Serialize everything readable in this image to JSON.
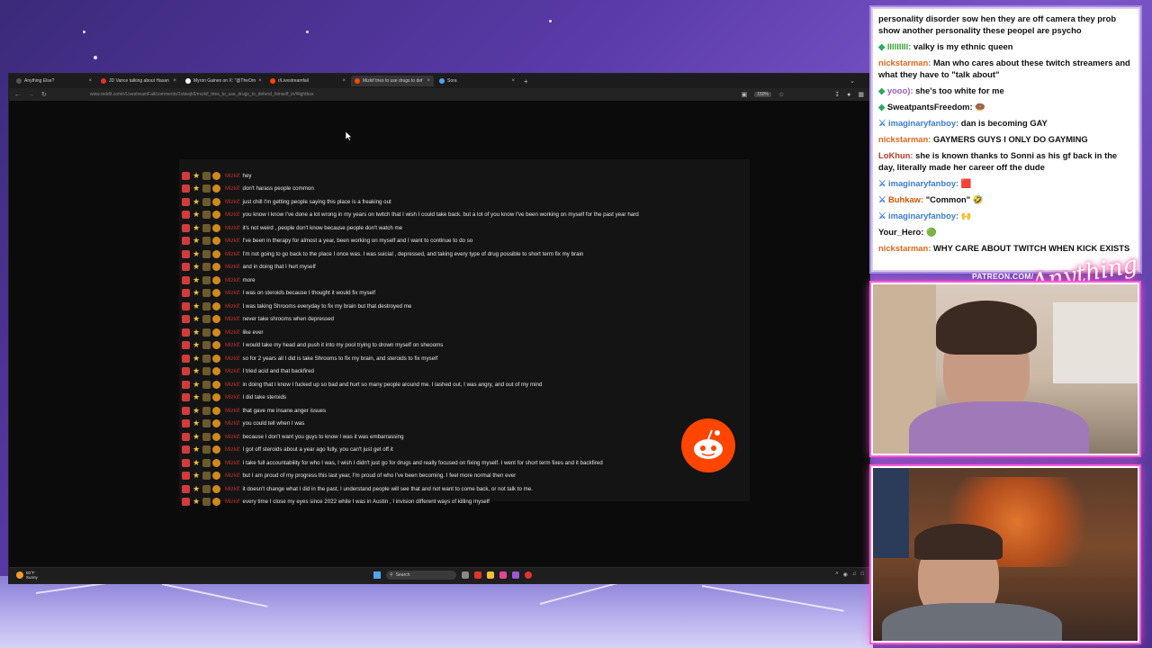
{
  "browser": {
    "tabs": [
      {
        "title": "Anything Else?",
        "favicon_color": "#555555"
      },
      {
        "title": "JD Vance talking about Hasan",
        "favicon_color": "#e0342c"
      },
      {
        "title": "Myron Gaines on X: \"@TheOm",
        "favicon_color": "#ffffff"
      },
      {
        "title": "r/Livestreamfail",
        "favicon_color": "#ff4500"
      },
      {
        "title": "Mizkif tries to use drugs to def",
        "favicon_color": "#ff4500"
      },
      {
        "title": "Sora",
        "favicon_color": "#4ea6f5"
      }
    ],
    "active_tab": 4,
    "url": "www.reddit.com/r/LivestreamFail/comments/1olwejk5/mizkif_tries_to_use_drugs_to_defend_himself_in/#lightbox",
    "zoom": "150%"
  },
  "chat_image": {
    "username": "Mizkif:",
    "messages": [
      "hey",
      "don't harass people common",
      "just chill I'm getting people saying this place is a freaking out",
      "you know I know I've done a lot wrong in my years on twitch that I wish I could take back. but a lot of you know I've been working on myself for the past year hard",
      "it's not weird , people don't know because people don't watch me",
      "I've been in therapy for almost a year, been working on myself and I want to continue to do so",
      "I'm not going to go back to the place I once was. I was suicial , depressed, and taking every type of drug possible to short term fix my brain",
      "and in doing that I hurt myself",
      "more",
      "I was on steroids because I thought it would fix myself",
      "I was taking Shrooms everyday to fix my brain but that destroyed me",
      "never take shrooms when depressed",
      "like ever",
      "I would take my head and push it into my pool trying to drown myself on sheooms",
      "so for 2 years all I did is take Shrooms to fix my brain, and steroids to fix myself",
      "I tried acid and that backfired",
      "in doing that I know I fucked up so bad and hurt so many people around me. I lashed out, I was angry, and out of my mind",
      "I did take steroids",
      "that gave me insane anger issues",
      "you could tell when I was",
      "because I don't want you guys to know I was it was embarrassing",
      "I got off steroids about a year ago fully, you can't just get off it",
      "I take full accountability for who I was, I wish I didn't just go for drugs and really focused on fixing myself. I went for short term fixes and it backfired",
      "but I am proud of my progress this last year, I'm proud of who I've been becoming. I feel more normal then ever",
      "it doesn't change what I did in the past, I understand people will see that and not want to come back, or not talk to me.",
      "every time I close my eyes since 2022 while I was in Austin , I invision different ways of killing myself"
    ]
  },
  "taskbar": {
    "weather_temp": "50°F",
    "weather_desc": "Sunny",
    "search_placeholder": "Search"
  },
  "stream_chat": {
    "top_line": "personality disorder sow hen they are off camera they prob show another personality these peopel are psycho",
    "messages": [
      {
        "user": "lllllllll:",
        "user_color": "#2f9e2f",
        "text": "valky is my ethnic queen",
        "badge": "gem"
      },
      {
        "user": "nickstarman:",
        "user_color": "#e0661a",
        "text": "Man who cares about these twitch streamers and what they have to \"talk about\"",
        "badge": ""
      },
      {
        "user": "yooo):",
        "user_color": "#9b59d0",
        "text": "she's too white for me",
        "badge": "gem"
      },
      {
        "user": "SweatpantsFreedom:",
        "user_color": "#111111",
        "text": "🍩",
        "badge": "gem"
      },
      {
        "user": "imaginaryfanboy:",
        "user_color": "#3a7bd5",
        "text": "dan is becoming GAY",
        "badge": "sword"
      },
      {
        "user": "nickstarman:",
        "user_color": "#e0661a",
        "text": "GAYMERS GUYS I ONLY DO GAYMING",
        "badge": ""
      },
      {
        "user": "LoKhun:",
        "user_color": "#c0392b",
        "text": "she is known thanks to Sonni as his gf back in the day, literally made her career off the dude",
        "badge": ""
      },
      {
        "user": "imaginaryfanboy:",
        "user_color": "#3a7bd5",
        "text": "🟥",
        "badge": "sword"
      },
      {
        "user": "Buhkaw:",
        "user_color": "#d35400",
        "text": "\"Common\" 🤣",
        "badge": "sword"
      },
      {
        "user": "imaginaryfanboy:",
        "user_color": "#3a7bd5",
        "text": "🙌",
        "badge": "sword"
      },
      {
        "user": "Your_Hero:",
        "user_color": "#111111",
        "text": "🟢",
        "badge": ""
      },
      {
        "user": "nickstarman:",
        "user_color": "#e0661a",
        "text": "WHY CARE ABOUT TWITCH WHEN KICK EXISTS",
        "badge": ""
      }
    ]
  },
  "overlay": {
    "patreon": "PATREON.COM/",
    "signature": "Anything Else?"
  }
}
